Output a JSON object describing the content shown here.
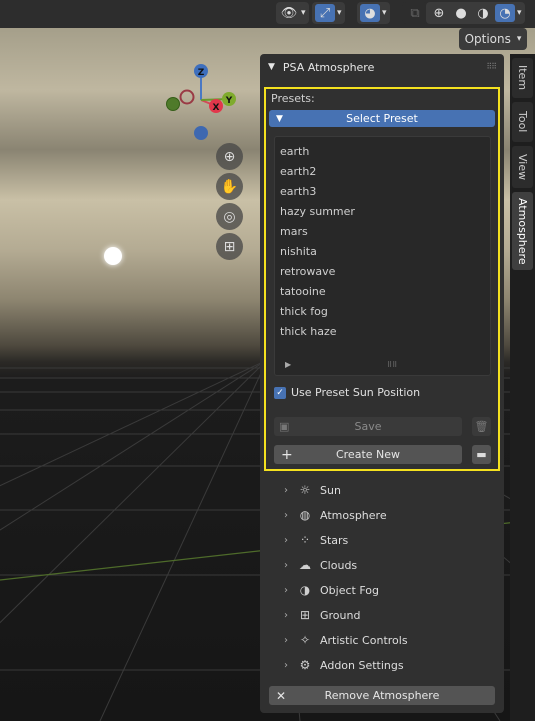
{
  "header": {
    "options_label": "Options"
  },
  "gizmo": {
    "z": "Z",
    "x": "X",
    "y": "Y"
  },
  "panel": {
    "title": "PSA Atmosphere",
    "presets_label": "Presets:",
    "select_preset_label": "Select Preset",
    "preset_items": [
      "earth",
      "earth2",
      "earth3",
      "hazy summer",
      "mars",
      "nishita",
      "retrowave",
      "tatooine",
      "thick fog",
      "thick haze"
    ],
    "use_sun_label": "Use Preset Sun Position",
    "use_sun_checked": true,
    "save_label": "Save",
    "create_new_label": "Create New",
    "sections": [
      {
        "label": "Sun",
        "icon": "sun-icon"
      },
      {
        "label": "Atmosphere",
        "icon": "globe-icon"
      },
      {
        "label": "Stars",
        "icon": "stars-icon"
      },
      {
        "label": "Clouds",
        "icon": "cloud-icon"
      },
      {
        "label": "Object Fog",
        "icon": "fog-icon"
      },
      {
        "label": "Ground",
        "icon": "ground-icon"
      },
      {
        "label": "Artistic Controls",
        "icon": "sparkle-icon"
      },
      {
        "label": "Addon Settings",
        "icon": "settings-icon"
      }
    ],
    "remove_label": "Remove Atmosphere"
  },
  "side_tabs": [
    "Item",
    "Tool",
    "View",
    "Atmosphere"
  ],
  "colors": {
    "accent": "#4772b3",
    "highlight": "#f4e11f",
    "panel": "#303030"
  }
}
